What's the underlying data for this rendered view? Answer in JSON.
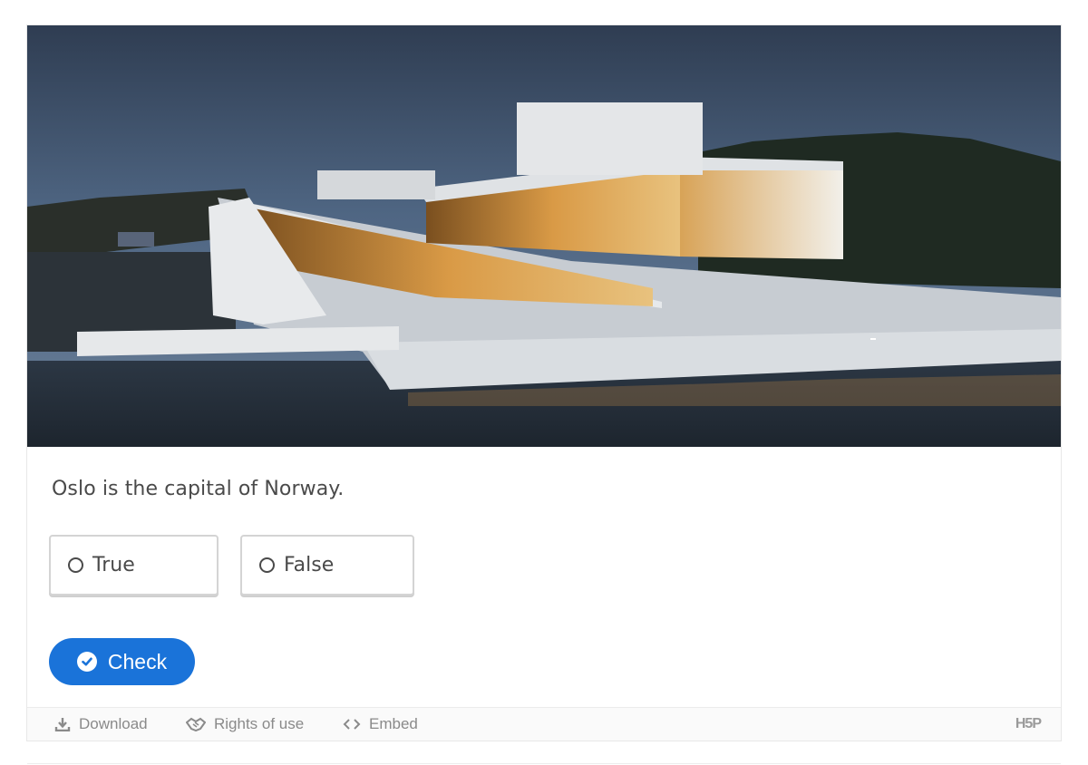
{
  "image": {
    "alt_subject": "oslo-opera-house-photo"
  },
  "question": {
    "text": "Oslo is the capital of Norway."
  },
  "answers": [
    {
      "label": "True"
    },
    {
      "label": "False"
    }
  ],
  "check_button": {
    "label": "Check",
    "color": "#1a73d9"
  },
  "footer": {
    "download_label": "Download",
    "rights_label": "Rights of use",
    "embed_label": "Embed",
    "logo_text": "H5P"
  }
}
